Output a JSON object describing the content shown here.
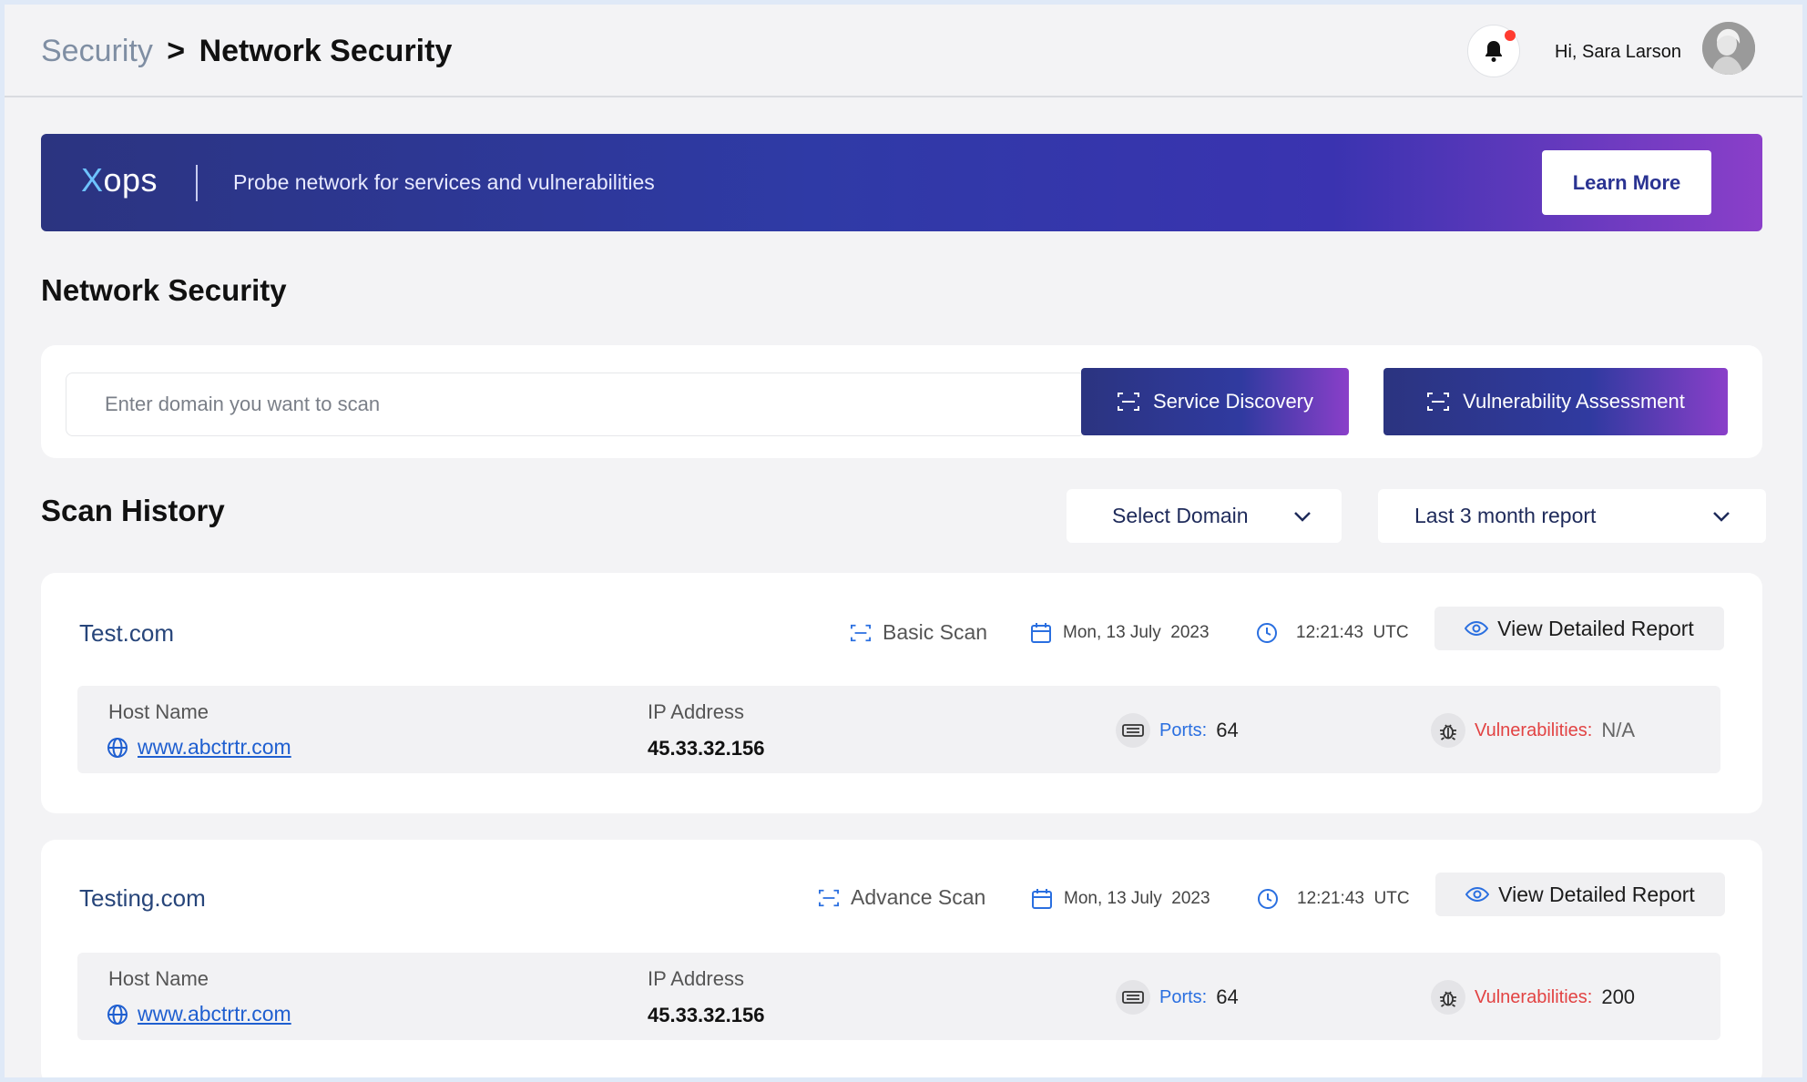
{
  "header": {
    "breadcrumb_parent": "Security",
    "breadcrumb_sep": ">",
    "breadcrumb_current": "Network Security",
    "greeting": "Hi, Sara Larson"
  },
  "banner": {
    "logo_x": "X",
    "logo_rest": "ops",
    "tagline": "Probe network for services and vulnerabilities",
    "learn_more": "Learn More"
  },
  "page_title": "Network Security",
  "scan": {
    "placeholder": "Enter domain you want to scan",
    "value": "",
    "service_discovery": "Service Discovery",
    "vulnerability_assessment": "Vulnerability Assessment"
  },
  "history": {
    "title": "Scan History",
    "filter_domain": "Select Domain",
    "filter_period": "Last 3 month report",
    "labels": {
      "host_name": "Host Name",
      "ip_address": "IP Address",
      "ports": "Ports:",
      "vulnerabilities": "Vulnerabilities:",
      "view_report": "View Detailed Report"
    },
    "items": [
      {
        "site": "Test.com",
        "scan_type": "Basic Scan",
        "date": "Mon, 13 July  2023",
        "time": "12:21:43  UTC",
        "host": "www.abctrtr.com",
        "ip": "45.33.32.156",
        "ports": "64",
        "vulnerabilities": "N/A"
      },
      {
        "site": "Testing.com",
        "scan_type": "Advance Scan",
        "date": "Mon, 13 July  2023",
        "time": "12:21:43  UTC",
        "host": "www.abctrtr.com",
        "ip": "45.33.32.156",
        "ports": "64",
        "vulnerabilities": "200"
      }
    ]
  },
  "colors": {
    "accent": "#2f3aa6",
    "gradient_end": "#8a3fc9",
    "link": "#1f5fd0",
    "danger": "#e24343",
    "notification_dot": "#ff3b30"
  },
  "icons": [
    "bell-icon",
    "scan-icon",
    "calendar-icon",
    "clock-icon",
    "eye-icon",
    "globe-icon",
    "ethernet-port-icon",
    "bug-icon",
    "chevron-down-icon"
  ]
}
